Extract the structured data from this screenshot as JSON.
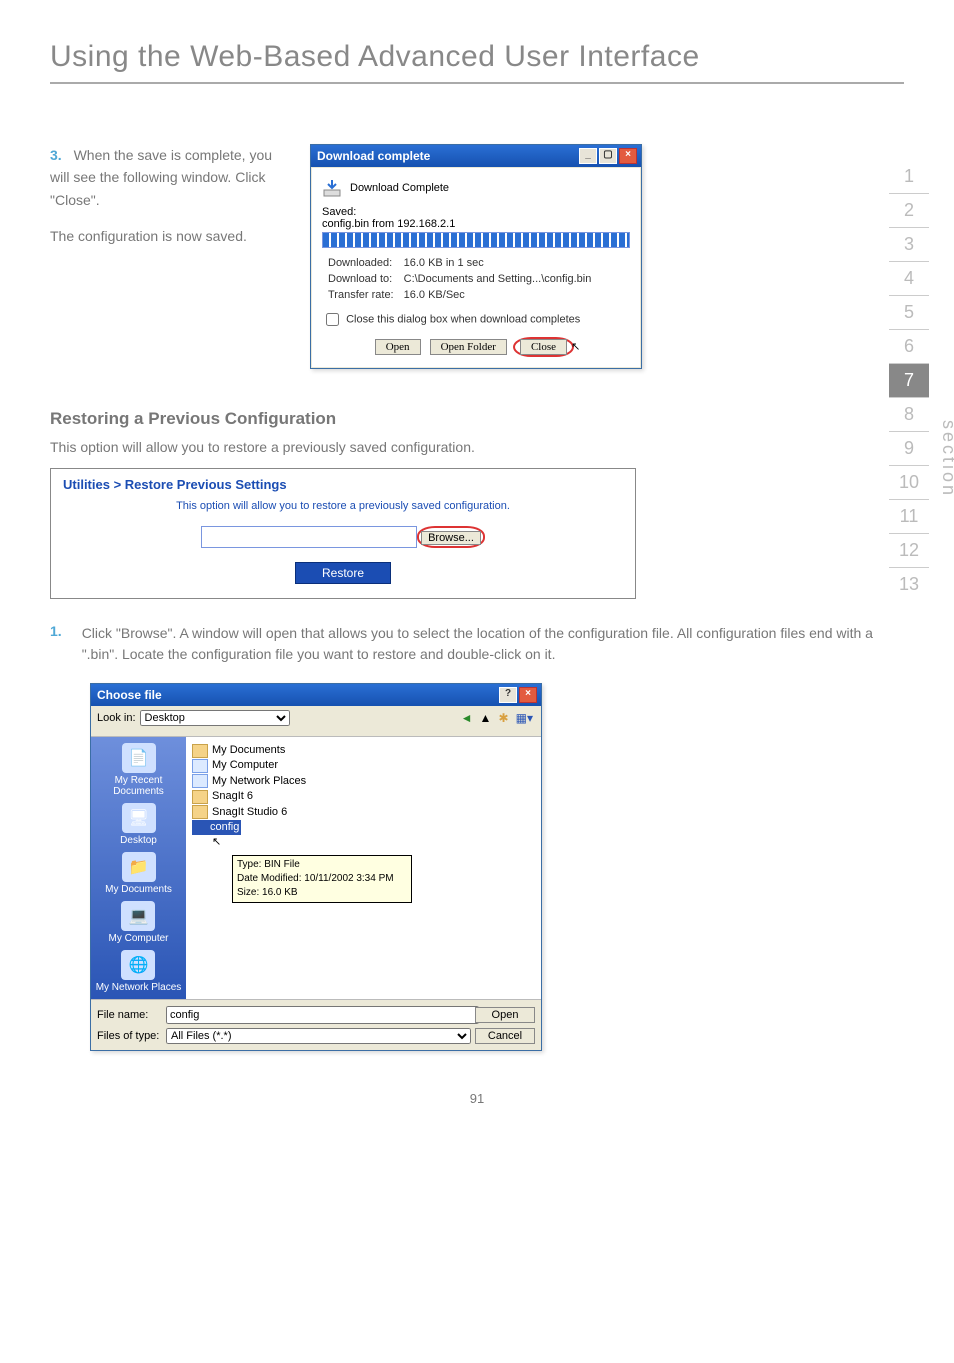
{
  "page": {
    "title": "Using the Web-Based Advanced User Interface",
    "number": "91"
  },
  "ladder": {
    "items": [
      "1",
      "2",
      "3",
      "4",
      "5",
      "6",
      "7",
      "8",
      "9",
      "10",
      "11",
      "12",
      "13"
    ],
    "active_index": 6,
    "label": "section"
  },
  "step3": {
    "num": "3.",
    "text1": "When the save is complete, you will see the following window. Click \"Close\".",
    "text2": "The configuration is now saved."
  },
  "download_dialog": {
    "title": "Download complete",
    "header": "Download Complete",
    "saved_label": "Saved:",
    "saved_file": "config.bin from 192.168.2.1",
    "rows": {
      "downloaded_label": "Downloaded:",
      "downloaded_value": "16.0 KB in 1 sec",
      "downloadto_label": "Download to:",
      "downloadto_value": "C:\\Documents and Setting...\\config.bin",
      "rate_label": "Transfer rate:",
      "rate_value": "16.0 KB/Sec"
    },
    "checkbox": "Close this dialog box when download completes",
    "buttons": {
      "open": "Open",
      "open_folder": "Open Folder",
      "close": "Close"
    }
  },
  "restore": {
    "heading": "Restoring a Previous Configuration",
    "desc": "This option will allow you to restore a previously saved configuration.",
    "panel_title": "Utilities > Restore Previous Settings",
    "panel_line": "This option will allow you to restore a previously saved configuration.",
    "browse": "Browse...",
    "restore_btn": "Restore"
  },
  "step1": {
    "num": "1.",
    "text": "Click \"Browse\". A window will open that allows you to select the location of the configuration file. All configuration files end with a \".bin\". Locate the configuration file you want to restore and double-click on it."
  },
  "choose_file": {
    "title": "Choose file",
    "lookin_label": "Look in:",
    "lookin_value": "Desktop",
    "side_items": [
      "My Recent Documents",
      "Desktop",
      "My Documents",
      "My Computer",
      "My Network Places"
    ],
    "list_items": [
      "My Documents",
      "My Computer",
      "My Network Places",
      "SnagIt 6",
      "SnagIt Studio 6",
      "config"
    ],
    "tooltip": {
      "type": "Type: BIN File",
      "modified": "Date Modified: 10/11/2002 3:34 PM",
      "size": "Size: 16.0 KB"
    },
    "filename_label": "File name:",
    "filename_value": "config",
    "filetype_label": "Files of type:",
    "filetype_value": "All Files (*.*)",
    "open": "Open",
    "cancel": "Cancel"
  }
}
